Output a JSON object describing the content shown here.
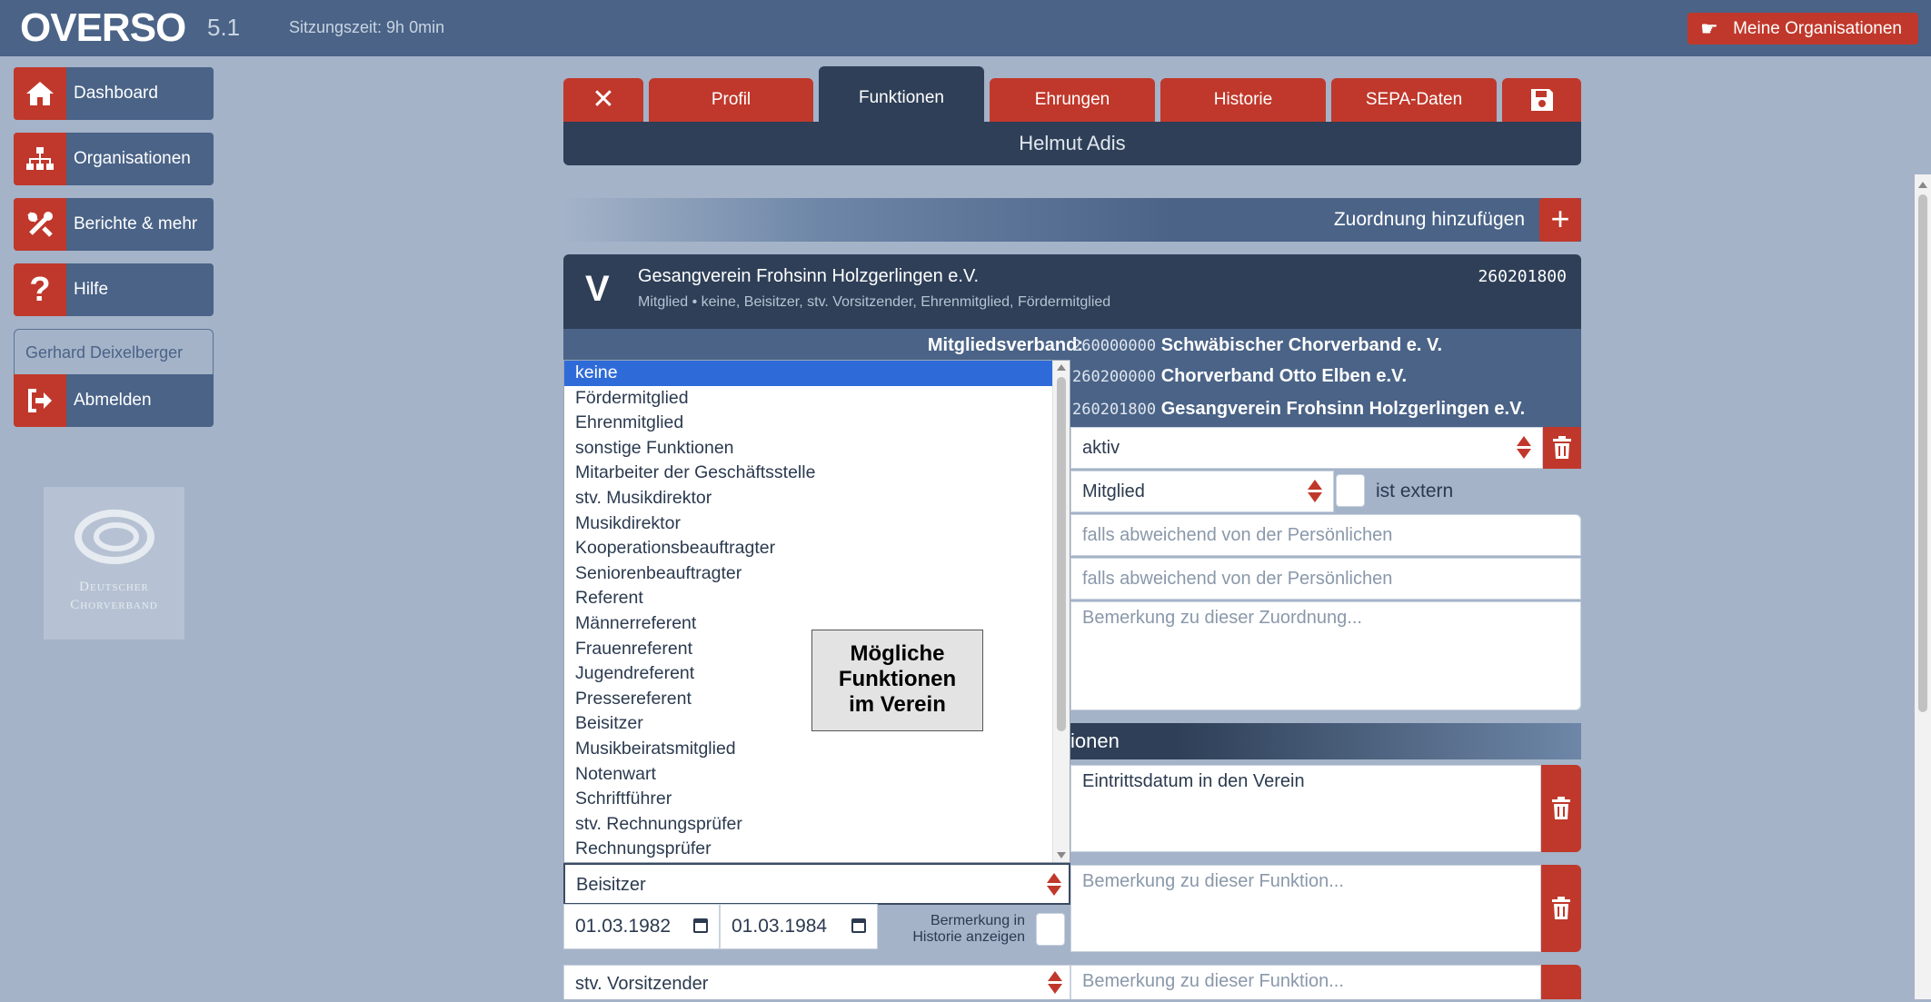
{
  "app": {
    "logo": "OVERSO",
    "version": "5.1",
    "session": "Sitzungszeit: 9h 0min",
    "orgs_button": "Meine Organisationen"
  },
  "sidebar": {
    "items": [
      {
        "label": "Dashboard",
        "icon": "home-icon"
      },
      {
        "label": "Organisationen",
        "icon": "sitemap-icon"
      },
      {
        "label": "Berichte & mehr",
        "icon": "tools-icon"
      },
      {
        "label": "Hilfe",
        "icon": "question-icon"
      }
    ],
    "user": "Gerhard Deixelberger",
    "logout": "Abmelden",
    "partner_logo_text": [
      "Deutscher",
      "Chorverband"
    ]
  },
  "tabs": {
    "close": "✕",
    "items": [
      "Profil",
      "Funktionen",
      "Ehrungen",
      "Historie",
      "SEPA-Daten"
    ],
    "active": "Funktionen"
  },
  "person": "Helmut Adis",
  "add_assignment": "Zuordnung hinzufügen",
  "org": {
    "badge": "V",
    "name": "Gesangverein Frohsinn Holzgerlingen e.V.",
    "summary": "Mitglied  •  keine, Beisitzer, stv. Vorsitzender, Ehrenmitglied, Fördermitglied",
    "number": "260201800",
    "hierarchy_label": "Mitgliedsverband:",
    "hierarchy": [
      {
        "num": "260000000",
        "name": "Schwäbischer Chorverband e. V."
      },
      {
        "num": "260200000",
        "name": "Chorverband Otto Elben e.V."
      },
      {
        "num": "260201800",
        "name": "Gesangverein Frohsinn Holzgerlingen e.V."
      }
    ]
  },
  "form": {
    "status": "aktiv",
    "role": "Mitglied",
    "extern_label": "ist extern",
    "ph_deviating_1": "falls abweichend von der Persönlichen",
    "ph_deviating_2": "falls abweichend von der Persönlichen",
    "ph_assignment_note": "Bemerkung zu dieser Zuordnung...",
    "functions_heading": "ionen",
    "entry_note": "Eintrittsdatum in den Verein",
    "ph_function_note": "Bemerkung zu dieser Funktion...",
    "function_2": "Beisitzer",
    "date_from": "01.03.1982",
    "date_to": "01.03.1984",
    "history_toggle_l1": "Bermerkung in",
    "history_toggle_l2": "Historie anzeigen",
    "function_3": "stv. Vorsitzender",
    "ph_function_note_3": "Bemerkung zu dieser Funktion..."
  },
  "dropdown": {
    "selected": "keine",
    "options": [
      "keine",
      "Fördermitglied",
      "Ehrenmitglied",
      "sonstige Funktionen",
      "Mitarbeiter der Geschäftsstelle",
      "stv. Musikdirektor",
      "Musikdirektor",
      "Kooperationsbeauftragter",
      "Seniorenbeauftragter",
      "Referent",
      "Männerreferent",
      "Frauenreferent",
      "Jugendreferent",
      "Pressereferent",
      "Beisitzer",
      "Musikbeiratsmitglied",
      "Notenwart",
      "Schriftführer",
      "stv. Rechnungsprüfer",
      "Rechnungsprüfer"
    ]
  },
  "annotation": [
    "Mögliche",
    "Funktionen",
    "im Verein"
  ],
  "colors": {
    "accent": "#c0382b",
    "dark": "#2e3f57",
    "mid": "#4a6387",
    "bg": "#a4b3c8",
    "selected": "#2f6bd8"
  }
}
